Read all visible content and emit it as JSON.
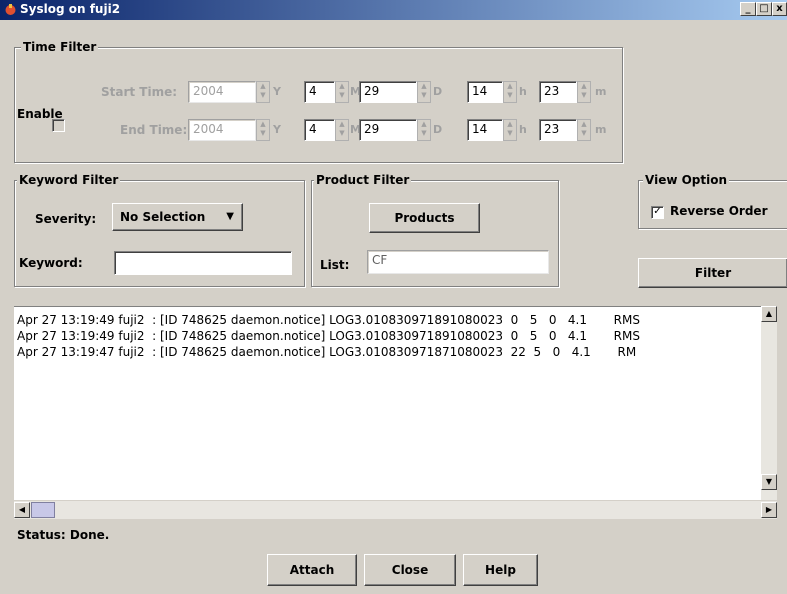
{
  "window": {
    "title": "Syslog on fuji2"
  },
  "time_filter": {
    "legend": "Time Filter",
    "enable_label": "Enable",
    "start_label": "Start Time:",
    "end_label": "End Time:",
    "start": {
      "year": "2004",
      "month": "4",
      "day": "29",
      "hour": "14",
      "minute": "23"
    },
    "end": {
      "year": "2004",
      "month": "4",
      "day": "29",
      "hour": "14",
      "minute": "23"
    },
    "units": {
      "y": "Y",
      "m": "M",
      "d": "D",
      "h": "h",
      "min": "m"
    }
  },
  "keyword_filter": {
    "legend": "Keyword Filter",
    "severity_label": "Severity:",
    "severity_value": "No Selection",
    "keyword_label": "Keyword:",
    "keyword_value": ""
  },
  "product_filter": {
    "legend": "Product Filter",
    "products_button": "Products",
    "list_label": "List:",
    "list_value": "CF"
  },
  "view_option": {
    "legend": "View Option",
    "reverse_order_label": "Reverse Order",
    "reverse_order_checked": true,
    "filter_button": "Filter"
  },
  "log_lines": [
    "Apr 27 13:19:49 fuji2  : [ID 748625 daemon.notice] LOG3.010830971891080023  0   5   0   4.1       RMS",
    "Apr 27 13:19:49 fuji2  : [ID 748625 daemon.notice] LOG3.010830971891080023  0   5   0   4.1       RMS",
    "Apr 27 13:19:47 fuji2  : [ID 748625 daemon.notice] LOG3.010830971871080023  22  5   0   4.1       RM"
  ],
  "status": "Status: Done.",
  "buttons": {
    "attach": "Attach",
    "close": "Close",
    "help": "Help"
  }
}
